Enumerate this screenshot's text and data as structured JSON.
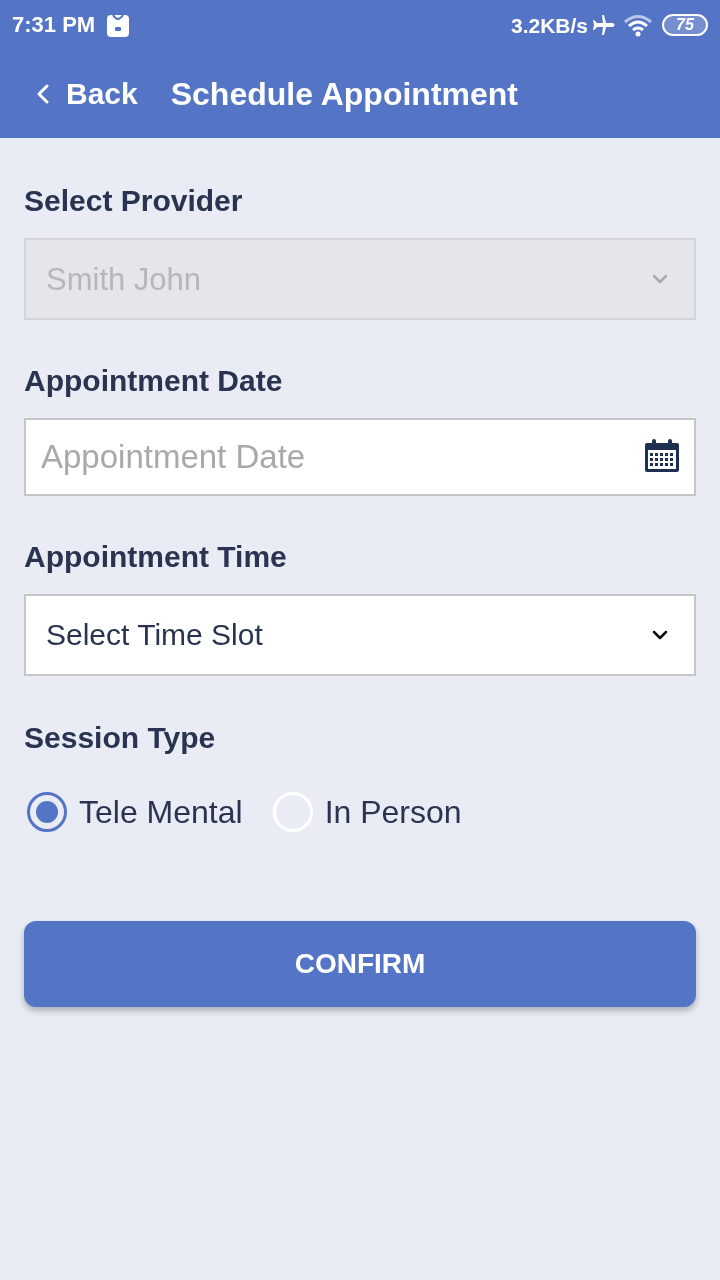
{
  "status_bar": {
    "time": "7:31 PM",
    "speed": "3.2KB/s",
    "battery": "75"
  },
  "header": {
    "back_label": "Back",
    "title": "Schedule Appointment"
  },
  "form": {
    "fields": [
      {
        "kind": "select",
        "label": "Select Provider",
        "value": "Smith John",
        "disabled": true
      },
      {
        "kind": "date",
        "label": "Appointment Date",
        "placeholder": "Appointment Date"
      },
      {
        "kind": "select",
        "label": "Appointment Time",
        "value": "Select Time Slot",
        "disabled": false
      }
    ],
    "session_type": {
      "label": "Session Type",
      "options": [
        {
          "label": "Tele Mental",
          "selected": true
        },
        {
          "label": "In Person",
          "selected": false
        }
      ]
    },
    "confirm_button": "CONFIRM"
  }
}
